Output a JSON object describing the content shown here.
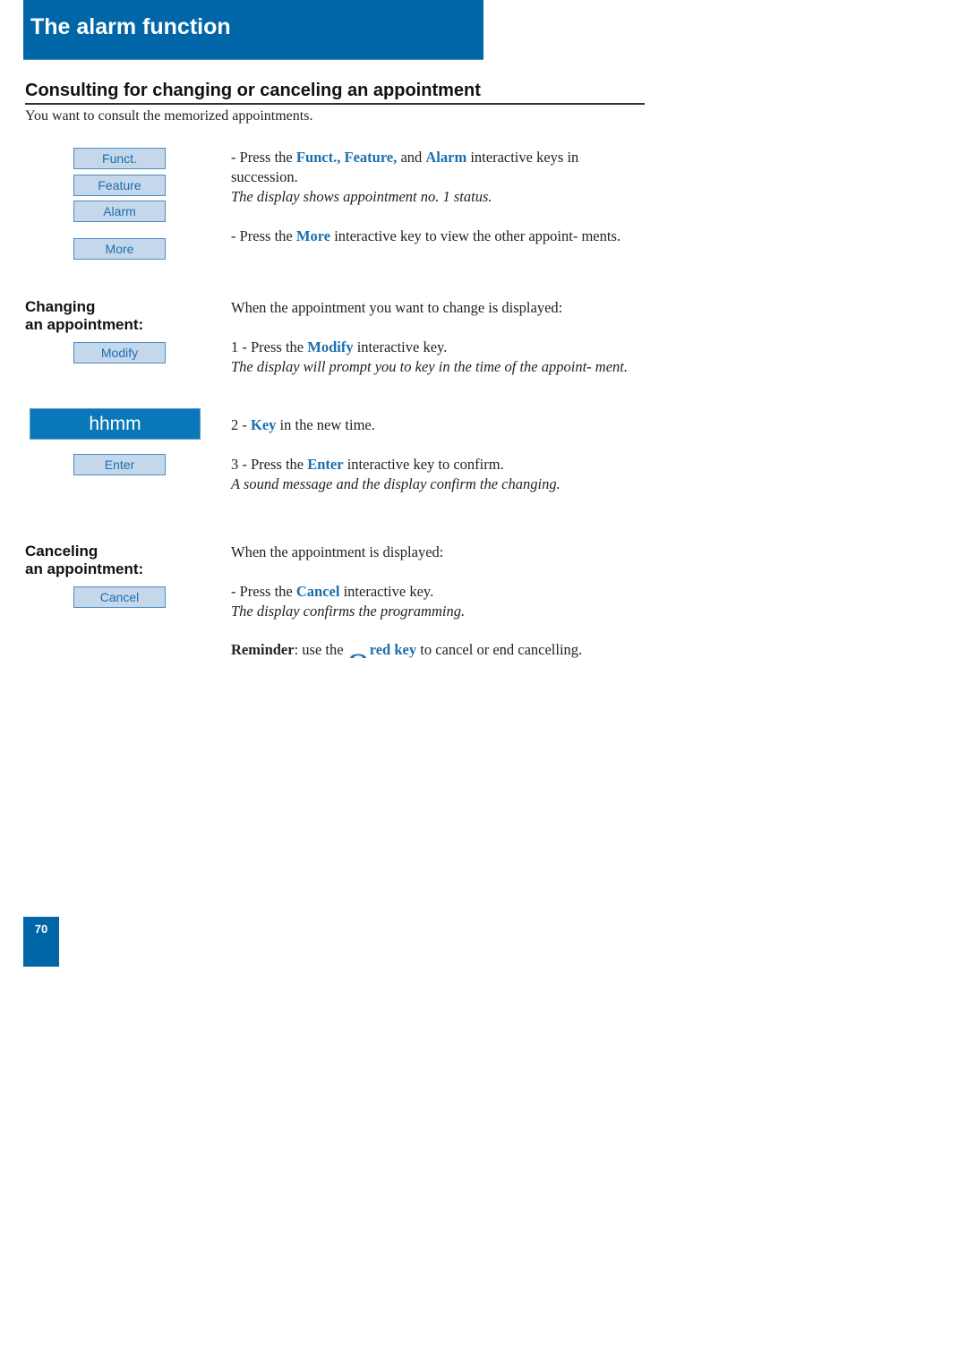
{
  "header": {
    "title": "The alarm function"
  },
  "section": {
    "title": "Consulting for changing or canceling an appointment",
    "intro": "You want to consult the memorized appointments."
  },
  "softkeys": {
    "funct": "Funct.",
    "feature": "Feature",
    "alarm": "Alarm",
    "more": "More",
    "modify": "Modify",
    "enter": "Enter",
    "cancel": "Cancel"
  },
  "display": {
    "value": "hhmm"
  },
  "side_labels": {
    "changing_line1": "Changing",
    "changing_line2": "an appointment:",
    "canceling_line1": "Canceling",
    "canceling_line2": "an appointment:"
  },
  "steps": {
    "consult": {
      "prefix": "- Press the ",
      "kw1": "Funct., Feature,",
      "mid": " and ",
      "kw2": "Alarm",
      "suffix": " interactive keys in succession.",
      "note": "The display shows appointment no. 1 status."
    },
    "more": {
      "prefix": "- Press the ",
      "kw": "More",
      "suffix": " interactive key to view the other appoint- ments."
    },
    "change_intro": "When the appointment you want to change is displayed:",
    "change1": {
      "prefix": "1 - Press the ",
      "kw": "Modify",
      "suffix": " interactive key.",
      "note": "The display will prompt you to key in the time of the appoint- ment."
    },
    "change2": {
      "prefix": "2 - ",
      "kw": "Key",
      "suffix": " in the new time."
    },
    "change3": {
      "prefix": "3 - Press the ",
      "kw": "Enter",
      "suffix": " interactive key to confirm.",
      "note": "A sound message and the display confirm the changing."
    },
    "cancel_intro": "When the appointment is displayed:",
    "cancel1": {
      "prefix": "- Press the ",
      "kw": "Cancel",
      "suffix": " interactive key.",
      "note": "The display confirms the programming."
    },
    "reminder": {
      "label": "Reminder",
      "prefix": ": use the ",
      "icon": "red-key-handset-icon",
      "kw": "red key",
      "suffix": " to cancel or end cancelling."
    }
  },
  "page_number": "70",
  "colors": {
    "brand_blue": "#0066a8",
    "keyword_blue": "#1a6fb0",
    "softkey_fill": "#c5d7ea",
    "display_fill": "#0a77b8"
  }
}
